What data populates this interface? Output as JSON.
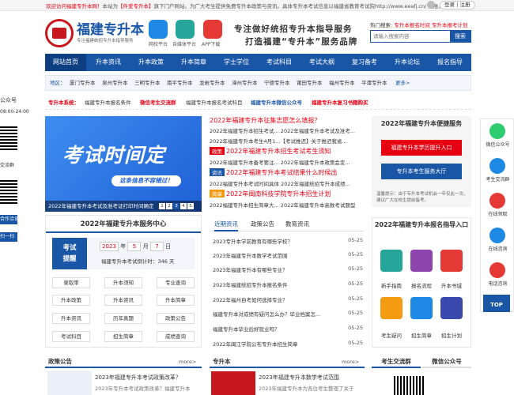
{
  "topbar": {
    "notice_red": "欢迎访问福建专升本网！",
    "notice_mid": "本站为",
    "notice_red2": "【件爱专升本】",
    "notice_rest": "旗下门户网站。为广大考生提供免费专升本政策与资讯。具体专升本考试信息以福建省教育考试院http://www.eeafj.cn/ 为准。",
    "login": "登录丨注册"
  },
  "header": {
    "logo_title": "福建专升本",
    "logo_sub": "专注福建统招专升本指导服务",
    "icons": [
      {
        "label": "网校平台",
        "icon": "play-icon",
        "color": "#1e88e5"
      },
      {
        "label": "自媒体平台",
        "icon": "broadcast-icon",
        "color": "#26a69a"
      },
      {
        "label": "APP下载",
        "icon": "app-icon",
        "color": "#e53935"
      }
    ],
    "slogan1": "专注做好统招专升本指导服务",
    "slogan2": "打造福建“专升本”服务品牌",
    "hot_label": "热门搜索:",
    "hot_links": "专升本报名时间  专升本报考计划",
    "search_placeholder": "请输入搜索内容",
    "search_button": "搜索"
  },
  "nav": [
    "网站首页",
    "升本资讯",
    "升本政策",
    "升本简章",
    "学士学位",
    "考试科目",
    "考试大纲",
    "复习备考",
    "升本论坛",
    "报名指导"
  ],
  "region": {
    "label": "地区：",
    "items": [
      "厦门专升本",
      "泉州专升本",
      "三明专升本",
      "南平专升本",
      "龙岩专升本",
      "漳州专升本",
      "宁德专升本",
      "莆田专升本",
      "福州专升本",
      "平潭专升本"
    ],
    "more": "更多>"
  },
  "quick": {
    "label": "专升本系统：",
    "items": [
      "福建专升本报名条件",
      "微信考生交流群",
      "福建专升本报名考试科目",
      "福建专升本微信公众号",
      "福建专升本复习书籍购买"
    ]
  },
  "banner": {
    "big_text": "考试时间定",
    "pill": "这条信息不容错过！",
    "caption": "2022年福建专升本考试及准考证打印时间确定",
    "dots": [
      "1",
      "2",
      "3",
      "4",
      "5"
    ]
  },
  "news": {
    "headline1": "2022年福建专升本征集志愿怎么填报？",
    "row1": "2022年福建专升本招生考试... 2022年福建专升本考试及准考...",
    "row2": "2022年福建专升本考生4月1...【考试推迟】关于推迟我省...",
    "tag1": "政策",
    "headline2": "2022年福建专升本招生考试考生须知",
    "row3": "2022年福建专升本备考要注... 2022年福建专升本政策会变...",
    "tag2": "资讯",
    "headline3": "2022年福建专升本考试结果什么时候出",
    "row4": "2022福建专升本考试时间具体 2022年福建统招专升本成绩...",
    "tag3": "简章",
    "headline4": "2022年闽南科技学院专升本招生计划",
    "row5": "2022福建专升本招生简章大... 2022年福建专升本高数考试题型"
  },
  "side_box": {
    "title": "2022年福建专升本便捷服务",
    "btn1": "福建专升本学历提升入口",
    "btn2": "专升本考生服务大厅",
    "note": "温馨提示：由于专升本考试机会一年仅此一次，建议广大在校生提前备考。"
  },
  "service": {
    "title": "2022年福建专升本服务中心",
    "countdown_label1": "考试",
    "countdown_label2": "提醒",
    "year": "2023",
    "month": "5",
    "day": "7",
    "year_unit": "年",
    "month_unit": "月",
    "day_unit": "日",
    "countdown_text": "福建专升本考试倒计时：346 天",
    "buttons": [
      "录取率",
      "升本须知",
      "专业查询",
      "升本政策",
      "升本资讯",
      "升本简章",
      "升本资讯",
      "历年真题",
      "政策公告",
      "考试科目",
      "招生简章",
      "成绩查询"
    ]
  },
  "tabs": {
    "items": [
      "近期资讯",
      "政策公告",
      "教育资讯"
    ],
    "list": [
      {
        "title": "2023专升本学前教育有哪些学校？",
        "date": "05-25"
      },
      {
        "title": "2023年福建专升本数学考试范围",
        "date": "05-25"
      },
      {
        "title": "2023年福建专升本有哪些专业？",
        "date": "05-25"
      },
      {
        "title": "2023年福建统招专升本报名条件",
        "date": "05-25"
      },
      {
        "title": "2022年福州自考如何选择专业？",
        "date": "05-25"
      },
      {
        "title": "福建专升本对成绩有疑问怎么办？毕业档案怎...",
        "date": "05-25"
      },
      {
        "title": "福建专升本毕业后好就业吗？",
        "date": "05-25"
      },
      {
        "title": "2022年闽江学院公布专升本招生简章",
        "date": "05-25"
      }
    ]
  },
  "entry": {
    "title": "2022年福建专升本报名指导入口",
    "items": [
      {
        "label": "新手指南",
        "color": "#26a69a"
      },
      {
        "label": "报名流程",
        "color": "#8e44ad"
      },
      {
        "label": "升本书城",
        "color": "#e53935"
      },
      {
        "label": "考生疑问",
        "color": "#f39c12"
      },
      {
        "label": "招生简章",
        "color": "#1e88e5"
      },
      {
        "label": "招生计划",
        "color": "#3949ab"
      }
    ]
  },
  "bottom": {
    "h1": "政策公告",
    "more1": "more>",
    "b1_title": "2023年福建专升本考试政策改革？",
    "b1_text": "2023年专升本考试政策改革？福建专升本",
    "h2": "专升本",
    "more2": "more>",
    "b2_title": "2023年福建专升本数学考试范围",
    "b2_text": "2023年福建专升本为各位考生整理了关于",
    "h3": "考生交流群",
    "h4": "微信公众号"
  },
  "left_float": {
    "top": "公众号",
    "time": "08:00-24:00",
    "mid": "交流群",
    "btn1": "合作洽谈",
    "btn2": "扫一扫"
  },
  "right_float": {
    "items": [
      {
        "label": "微信公众号",
        "icon": "wechat-icon",
        "color": "#2ecc71"
      },
      {
        "label": "考生交流群",
        "icon": "group-icon",
        "color": "#1e88e5"
      },
      {
        "label": "在线领取",
        "icon": "gift-icon",
        "color": "#e53935"
      },
      {
        "label": "在线咨询",
        "icon": "chat-icon",
        "color": "#1e88e5"
      },
      {
        "label": "电话咨询",
        "icon": "phone-icon",
        "color": "#e53935"
      }
    ],
    "top": "TOP"
  }
}
